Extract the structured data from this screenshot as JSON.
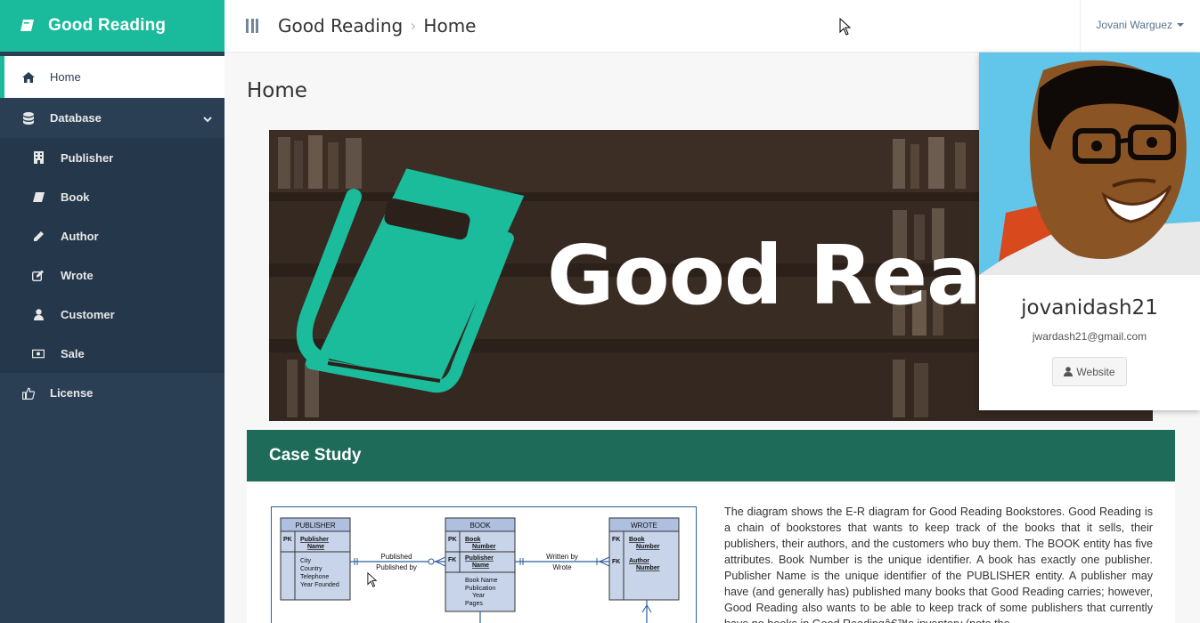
{
  "brand": {
    "title": "Good Reading"
  },
  "sidebar": {
    "home": "Home",
    "database": "Database",
    "items": [
      "Publisher",
      "Book",
      "Author",
      "Wrote",
      "Customer",
      "Sale"
    ],
    "license": "License"
  },
  "topbar": {
    "breadcrumb": [
      "Good Reading",
      "Home"
    ],
    "user": "Jovani Warguez"
  },
  "main": {
    "title": "Home",
    "hero_text": "Good Read",
    "case_study": {
      "title": "Case Study",
      "text": "The diagram shows the E-R diagram for Good Reading Bookstores. Good Reading is a chain of bookstores that wants to keep track of the books that it sells, their publishers, their authors, and the customers who buy them. The BOOK entity has five attributes. Book Number is the unique identifier. A book has exactly one publisher. Publisher Name is the unique identifier of the PUBLISHER entity. A publisher may have (and generally has) published many books that Good Reading carries; however, Good Reading also wants to be able to keep track of some publishers that currently have no books in Good Readingâ€™s inventory (note the"
    },
    "er": {
      "publisher": {
        "title": "PUBLISHER",
        "pk": "PK",
        "key": "Publisher Name",
        "attrs": [
          "City",
          "Country",
          "Telephone",
          "Year Founded"
        ]
      },
      "book": {
        "title": "BOOK",
        "pk": "PK",
        "fk": "FK",
        "key": "Book Number",
        "fkey": "Publisher Name",
        "attrs": [
          "Book Name",
          "Publication Year",
          "Pages"
        ]
      },
      "wrote": {
        "title": "WROTE",
        "fk1": "FK",
        "fk2": "FK",
        "key1": "Book Number",
        "key2": "Author Number"
      },
      "rel1": [
        "Published",
        "Published by"
      ],
      "rel2": [
        "Written by",
        "Wrote"
      ]
    }
  },
  "profile": {
    "username": "jovanidash21",
    "email": "jwardash21@gmail.com",
    "button": "Website"
  },
  "colors": {
    "sidebar": "#2a3f54",
    "accent": "#1abb9c",
    "case_header": "#1e6b5a"
  }
}
